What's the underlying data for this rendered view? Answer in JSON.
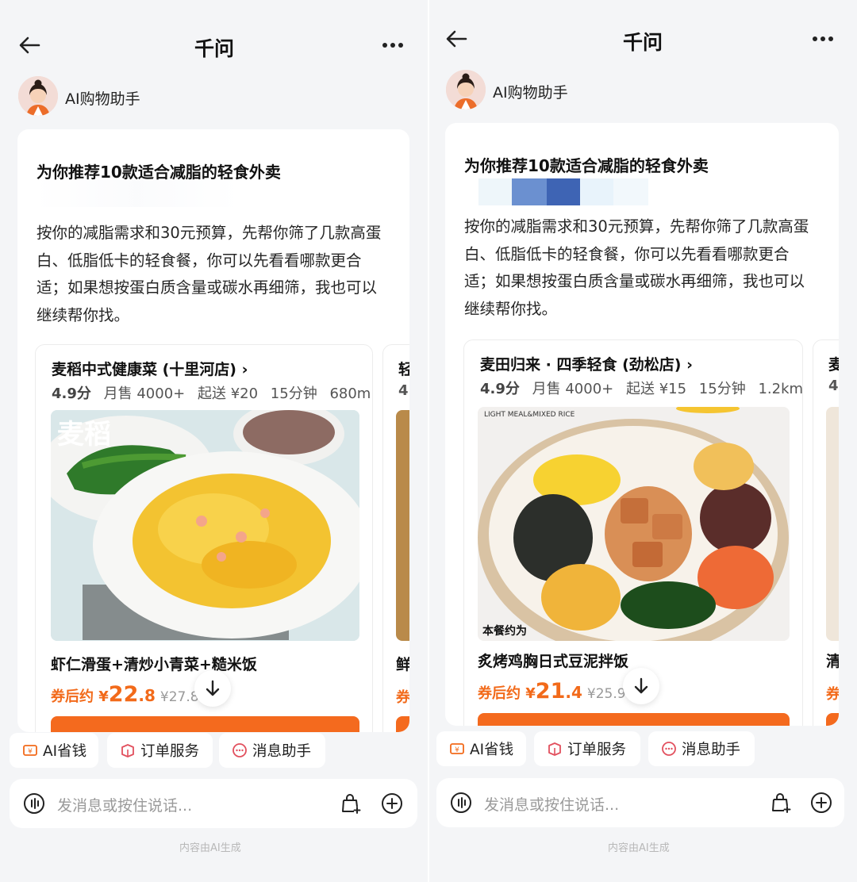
{
  "screens": [
    {
      "header": {
        "title": "千问"
      },
      "assistant": {
        "name": "AI购物助手"
      },
      "message": {
        "title": "为你推荐10款适合减脂的轻食外卖",
        "body_lines": [
          "按你的减脂需求和30元预算，先帮你筛了几款高蛋",
          "白、低脂低卡的轻食餐，你可以先看看哪款更合",
          "适；如果想按蛋白质含量或碳水再细筛，我也可以",
          "继续帮你找。"
        ]
      },
      "shop": {
        "name": "麦稻中式健康菜 (十里河店)",
        "chevron": "›",
        "rating": "4.9分",
        "monthly_sales": "月售 4000+",
        "min_order": "起送 ¥20",
        "delivery_time": "15分钟",
        "distance": "680m",
        "image_text": "麦稻",
        "dish_name": "虾仁滑蛋+清炒小青菜+糙米饭",
        "price_prefix": "券后约 ¥",
        "price_int": "22",
        "price_dec": ".8",
        "price_original": "¥27.8"
      },
      "peek_shop": {
        "name_char": "轻",
        "rating_char": "4",
        "dish_char": "鲜",
        "price_char": "券"
      },
      "chips": [
        {
          "label": "AI省钱",
          "icon": "yen-coupon-icon"
        },
        {
          "label": "订单服务",
          "icon": "order-box-icon"
        },
        {
          "label": "消息助手",
          "icon": "message-bubble-icon"
        }
      ],
      "input": {
        "placeholder": "发消息或按住说话..."
      },
      "footer_note": "内容由AI生成"
    },
    {
      "header": {
        "title": "千问"
      },
      "assistant": {
        "name": "AI购物助手"
      },
      "message": {
        "title": "为你推荐10款适合减脂的轻食外卖",
        "body_lines": [
          "按你的减脂需求和30元预算，先帮你筛了几款高蛋",
          "白、低脂低卡的轻食餐，你可以先看看哪款更合",
          "适；如果想按蛋白质含量或碳水再细筛，我也可以",
          "继续帮你找。"
        ]
      },
      "shop": {
        "name": "麦田归来 · 四季轻食 (劲松店)",
        "chevron": "›",
        "rating": "4.9分",
        "monthly_sales": "月售 4000+",
        "min_order": "起送 ¥15",
        "delivery_time": "15分钟",
        "distance": "1.2km",
        "image_text": "LIGHT MEAL&MIXED RICE",
        "image_badge": "本餐约为",
        "dish_name": "炙烤鸡胸日式豆泥拌饭",
        "price_prefix": "券后约 ¥",
        "price_int": "21",
        "price_dec": ".4",
        "price_original": "¥25.9"
      },
      "peek_shop": {
        "name_char": "麦",
        "rating_char": "4",
        "dish_char": "清",
        "price_char": "券"
      },
      "chips": [
        {
          "label": "AI省钱",
          "icon": "yen-coupon-icon"
        },
        {
          "label": "订单服务",
          "icon": "order-box-icon"
        },
        {
          "label": "消息助手",
          "icon": "message-bubble-icon"
        }
      ],
      "input": {
        "placeholder": "发消息或按住说话..."
      },
      "footer_note": "内容由AI生成"
    }
  ],
  "colors": {
    "accent_orange": "#f26a1a",
    "order_bar": "#f46a1e",
    "blur_blue": "#3b6fc4"
  }
}
